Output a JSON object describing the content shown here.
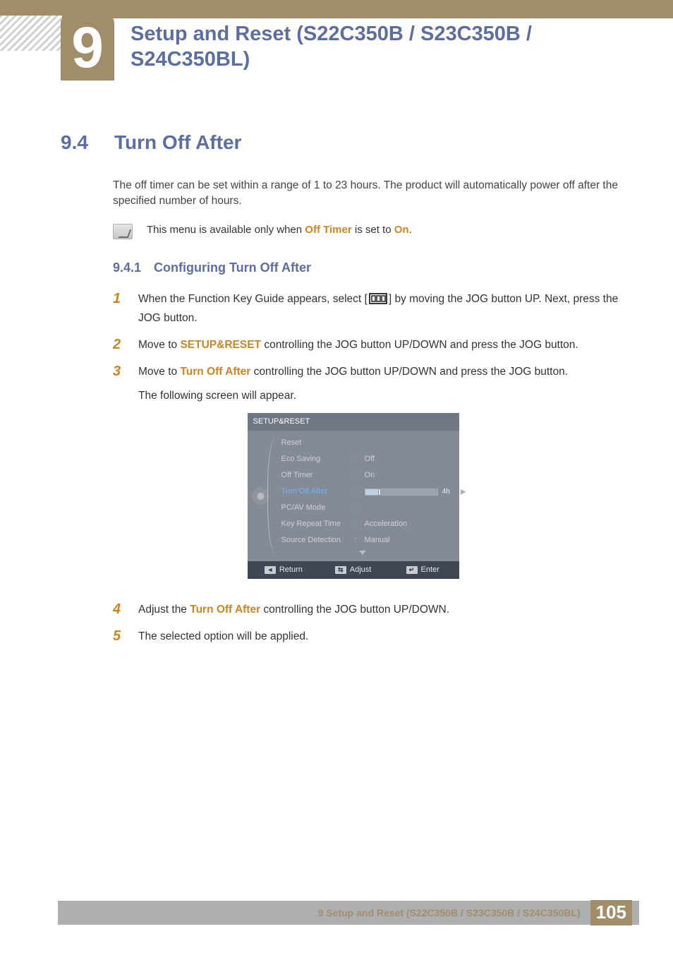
{
  "chapter": {
    "number": "9",
    "title": "Setup and Reset (S22C350B / S23C350B / S24C350BL)"
  },
  "section": {
    "number": "9.4",
    "title": "Turn Off After"
  },
  "intro": "The off timer can be set within a range of 1 to 23 hours. The product will automatically power off after the specified number of hours.",
  "note": {
    "prefix": "This menu is available only when ",
    "hl1": "Off Timer",
    "mid": " is set to ",
    "hl2": "On",
    "suffix": "."
  },
  "subsection": {
    "number": "9.4.1",
    "title": "Configuring Turn Off After"
  },
  "steps": {
    "s1a": "When the Function Key Guide appears, select [",
    "s1b": "] by moving the JOG button UP. Next, press the JOG button.",
    "s2a": "Move to ",
    "s2hl": "SETUP&RESET",
    "s2b": " controlling the JOG button UP/DOWN and press the JOG button.",
    "s3a": "Move to ",
    "s3hl": "Turn Off After",
    "s3b": " controlling the JOG button UP/DOWN and press the JOG button.",
    "s3c": "The following screen will appear.",
    "s4a": "Adjust the ",
    "s4hl": "Turn Off After",
    "s4b": " controlling the JOG button UP/DOWN.",
    "s5": "The selected option will be applied."
  },
  "step_numbers": {
    "n1": "1",
    "n2": "2",
    "n3": "3",
    "n4": "4",
    "n5": "5"
  },
  "osd": {
    "title": "SETUP&RESET",
    "rows": [
      {
        "label": "Reset",
        "value": ""
      },
      {
        "label": "Eco Saving",
        "value": "Off"
      },
      {
        "label": "Off Timer",
        "value": "On"
      },
      {
        "label": "Turn Off After",
        "value": "4h",
        "highlight": true,
        "slider": true
      },
      {
        "label": "PC/AV Mode",
        "value": ""
      },
      {
        "label": "Key Repeat Time",
        "value": "Acceleration"
      },
      {
        "label": "Source Detection",
        "value": "Manual"
      }
    ],
    "footer": {
      "return": "Return",
      "adjust": "Adjust",
      "enter": "Enter"
    }
  },
  "footer": {
    "title": "9 Setup and Reset (S22C350B / S23C350B / S24C350BL)",
    "page": "105"
  }
}
